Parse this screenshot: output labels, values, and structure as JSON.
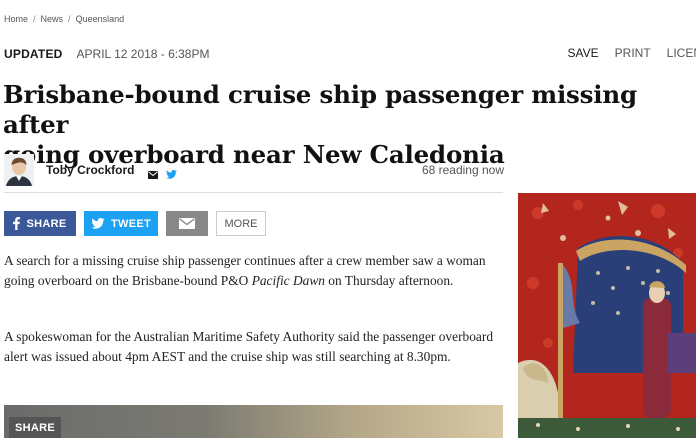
{
  "breadcrumb": [
    {
      "label": "Home"
    },
    {
      "label": "News"
    },
    {
      "label": "Queensland"
    }
  ],
  "breadcrumb_separator": "/",
  "meta": {
    "updated_label": "UPDATED",
    "timestamp": "APRIL 12 2018 - 6:38PM"
  },
  "tools": {
    "save": "SAVE",
    "print": "PRINT",
    "license": "LICEN"
  },
  "headline": {
    "line1": "Brisbane-bound cruise ship passenger missing after",
    "line2": "going overboard near New Caledonia"
  },
  "byline": {
    "author": "Toby Crockford",
    "reading": "68 reading now"
  },
  "share": {
    "facebook": "SHARE",
    "twitter": "TWEET",
    "more": "MORE"
  },
  "article": {
    "p1_before": "A search for a missing cruise ship passenger continues after a crew member saw a woman going overboard on the Brisbane-bound P&O ",
    "p1_italic": "Pacific Dawn",
    "p1_after": " on Thursday afternoon.",
    "p2": "A spokeswoman for the Australian Maritime Safety Authority said the passenger overboard alert was issued about 4pm AEST and the cruise ship was still searching at 8.30pm."
  },
  "video": {
    "share_label": "SHARE"
  },
  "colors": {
    "facebook": "#3b5998",
    "twitter": "#1da1f2",
    "email": "#888888"
  }
}
